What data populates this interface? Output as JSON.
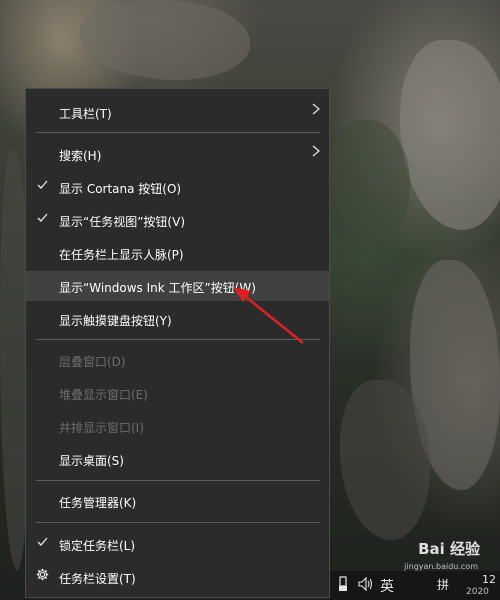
{
  "menu": {
    "toolbars": "工具栏(T)",
    "search": "搜索(H)",
    "show_cortana": "显示 Cortana 按钮(O)",
    "show_task_view": "显示“任务视图”按钮(V)",
    "show_people": "在任务栏上显示人脉(P)",
    "show_ink": "显示“Windows Ink 工作区”按钮(W)",
    "show_touch_keyboard": "显示触摸键盘按钮(Y)",
    "cascade": "层叠窗口(D)",
    "stacked": "堆叠显示窗口(E)",
    "side_by_side": "并排显示窗口(I)",
    "show_desktop": "显示桌面(S)",
    "task_manager": "任务管理器(K)",
    "lock_taskbar": "锁定任务栏(L)",
    "taskbar_settings": "任务栏设置(T)"
  },
  "tray": {
    "ime_lang": "英",
    "ime_mode": "拼",
    "clock_partial": "12",
    "date_partial": "2020"
  },
  "watermark": {
    "brand": "Bai 经验",
    "url": "jingyan.baidu.com"
  },
  "colors": {
    "menu_bg": "#2b2b2b",
    "highlight": "#414141",
    "arrow": "#e02020"
  },
  "icons": [
    "checkmark-icon",
    "chevron-right-icon",
    "gear-icon",
    "usb-icon",
    "volume-icon",
    "arrow-annotation"
  ]
}
